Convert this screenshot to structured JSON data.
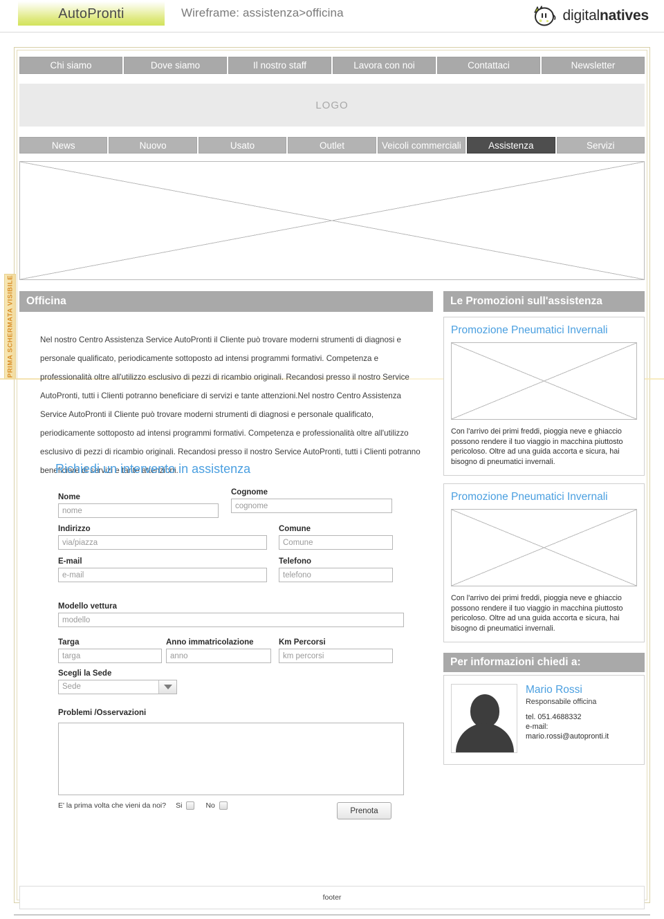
{
  "header": {
    "brand": "AutoPronti",
    "wireframe_title": "Wireframe: assistenza>officina",
    "logo_light": "digital",
    "logo_bold": "natives"
  },
  "annotation": {
    "vertical_label": "PRIMA SCHERMATA VISIBILE"
  },
  "nav_top": {
    "items": [
      {
        "label": "Chi siamo"
      },
      {
        "label": "Dove siamo"
      },
      {
        "label": "Il nostro staff"
      },
      {
        "label": "Lavora con noi"
      },
      {
        "label": "Contattaci"
      },
      {
        "label": "Newsletter"
      }
    ]
  },
  "logo_band": {
    "label": "LOGO"
  },
  "nav_secondary": {
    "items": [
      {
        "label": "News",
        "active": false
      },
      {
        "label": "Nuovo",
        "active": false
      },
      {
        "label": "Usato",
        "active": false
      },
      {
        "label": "Outlet",
        "active": false
      },
      {
        "label": "Veicoli commerciali",
        "active": false
      },
      {
        "label": "Assistenza",
        "active": true
      },
      {
        "label": "Servizi",
        "active": false
      }
    ]
  },
  "main": {
    "section_title": "Officina",
    "body_paragraph": "Nel nostro Centro Assistenza Service AutoPronti il Cliente può trovare moderni strumenti di diagnosi e personale qualificato, periodicamente sottoposto ad intensi programmi formativi. Competenza e professionalità oltre all'utilizzo esclusivo di pezzi di ricambio originali. Recandosi presso il nostro Service AutoPronti, tutti i Clienti potranno beneficiare di servizi e tante attenzioni.Nel nostro Centro Assistenza Service AutoPronti il Cliente può trovare moderni strumenti di diagnosi e personale qualificato, periodicamente sottoposto ad intensi programmi formativi. Competenza e professionalità oltre all'utilizzo esclusivo di pezzi di ricambio originali. Recandosi presso il nostro Service AutoPronti, tutti i Clienti potranno beneficiare di servizi e tante attenzioni."
  },
  "form": {
    "title": "Richiedi un intervento in assistenza",
    "fields": {
      "nome": {
        "label": "Nome",
        "placeholder": "nome"
      },
      "cognome": {
        "label": "Cognome",
        "placeholder": "cognome"
      },
      "indirizzo": {
        "label": "Indirizzo",
        "placeholder": "via/piazza"
      },
      "comune": {
        "label": "Comune",
        "placeholder": "Comune"
      },
      "email": {
        "label": "E-mail",
        "placeholder": "e-mail"
      },
      "telefono": {
        "label": "Telefono",
        "placeholder": "telefono"
      },
      "modello": {
        "label": "Modello vettura",
        "placeholder": "modello"
      },
      "targa": {
        "label": "Targa",
        "placeholder": "targa"
      },
      "anno": {
        "label": "Anno immatricolazione",
        "placeholder": "anno"
      },
      "km": {
        "label": "Km Percorsi",
        "placeholder": "km percorsi"
      },
      "sede": {
        "label": "Scegli la Sede",
        "value": "Sede"
      },
      "problemi": {
        "label": "Problemi /Osservazioni",
        "value": ""
      }
    },
    "first_time_question": "E' la prima volta che vieni da noi?",
    "first_time_yes": "Si",
    "first_time_no": "No",
    "submit_label": "Prenota"
  },
  "sidebar": {
    "promo_header": "Le Promozioni sull'assistenza",
    "promos": [
      {
        "title": "Promozione Pneumatici Invernali",
        "text": "Con l'arrivo dei primi freddi, pioggia neve e ghiaccio possono rendere il tuo viaggio in macchina piuttosto pericoloso. Oltre ad una guida accorta e sicura, hai bisogno di pneumatici invernali."
      },
      {
        "title": "Promozione Pneumatici Invernali",
        "text": "Con l'arrivo dei primi freddi, pioggia neve e ghiaccio possono rendere il tuo viaggio in macchina piuttosto pericoloso. Oltre ad una guida accorta e sicura, hai bisogno di pneumatici invernali."
      }
    ],
    "info_header": "Per informazioni chiedi a:",
    "contact": {
      "name": "Mario Rossi",
      "role": "Responsabile officina",
      "phone": "tel. 051.4688332",
      "email_label": "e-mail:",
      "email": "mario.rossi@autopronti.it"
    }
  },
  "footer": {
    "label": "footer"
  },
  "colors": {
    "accent_blue": "#4a9fe0",
    "header_gray": "#a9a9a9",
    "active_tab": "#4e4e4e",
    "annotation_orange": "#d98f2a",
    "brand_green": "#d2e35c"
  }
}
